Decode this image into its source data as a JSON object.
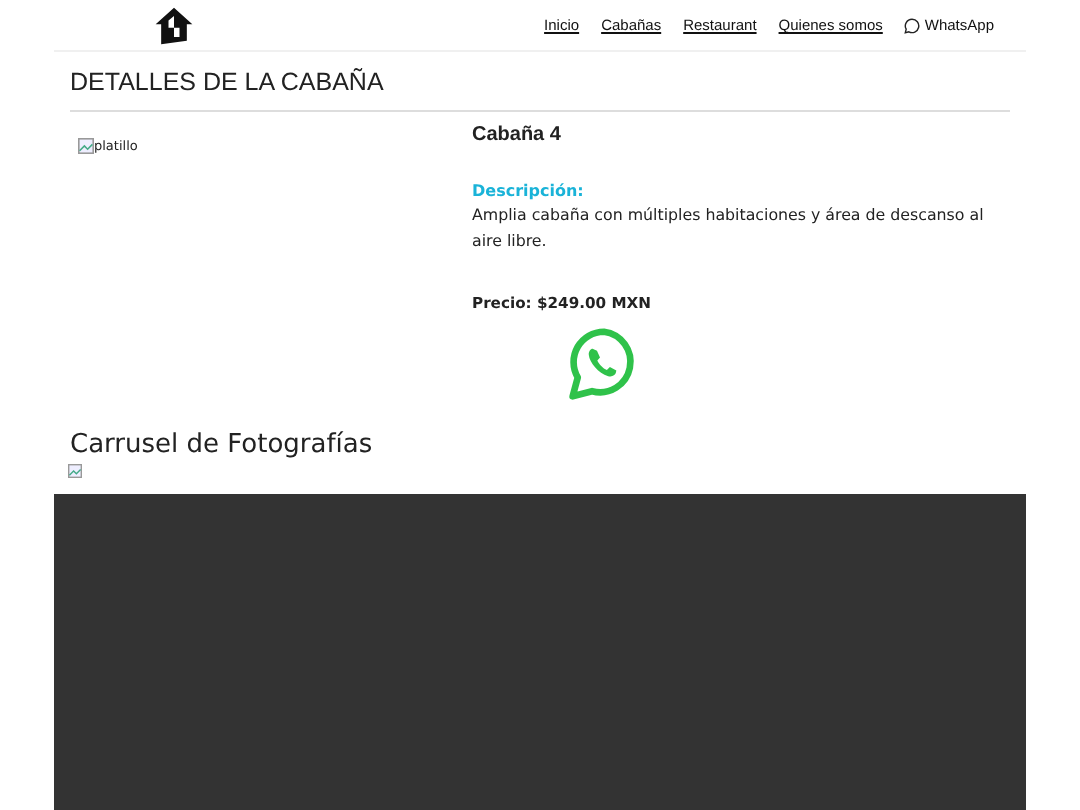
{
  "nav": [
    {
      "label": "Inicio",
      "kind": "link"
    },
    {
      "label": "Cabañas",
      "kind": "link"
    },
    {
      "label": "Restaurant",
      "kind": "link"
    },
    {
      "label": "Quienes somos",
      "kind": "link"
    },
    {
      "label": "WhatsApp",
      "kind": "whatsapp"
    }
  ],
  "page_title": "DETALLES DE LA CABAÑA",
  "image_alt": "platillo",
  "cabin": {
    "name": "Cabaña 4",
    "description_label": "Descripción:",
    "description": "Amplia cabaña con múltiples habitaciones y área de descanso al aire libre.",
    "price": "Precio: $249.00 MXN"
  },
  "carousel_title": "Carrusel de Fotografías"
}
